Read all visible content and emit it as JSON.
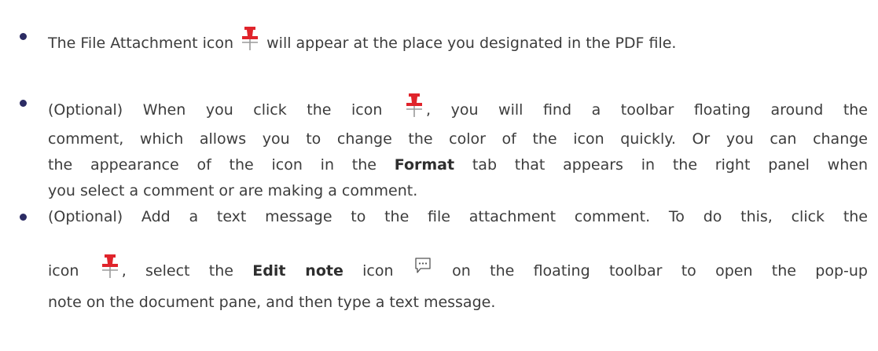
{
  "bullets": [
    {
      "lines": [
        {
          "before": "The File Attachment icon",
          "icon": "pushpin-icon",
          "after": "will appear at the place you designated in the PDF file."
        }
      ]
    },
    {
      "lines": [
        {
          "before": "(Optional) When you click the icon",
          "icon": "pushpin-icon",
          "after": ", you will find a toolbar floating around the"
        },
        {
          "text": "comment, which allows you to change the color of the icon quickly. Or you can change"
        },
        {
          "before": "the appearance of the icon in the",
          "bold": "Format",
          "after": "tab that appears in the right panel when"
        },
        {
          "text": "you select a comment or are making a comment."
        }
      ]
    },
    {
      "lines": [
        {
          "text": "(Optional) Add a text message to the file attachment comment. To do this, click the"
        },
        {
          "before": "icon",
          "icon": "pushpin-icon",
          "middle": ", select the",
          "bold": "Edit note",
          "middle2": "icon",
          "icon2": "note-bubble-icon",
          "after": "on the floating toolbar to open the pop-up"
        },
        {
          "text": "note on the document pane, and then type a text message."
        }
      ]
    }
  ],
  "colors": {
    "text": "#3c3c3c",
    "bullet": "#2b2b63",
    "pin_head": "#e0242b",
    "pin_needle": "#9a9a9a",
    "note_icon": "#555555"
  }
}
